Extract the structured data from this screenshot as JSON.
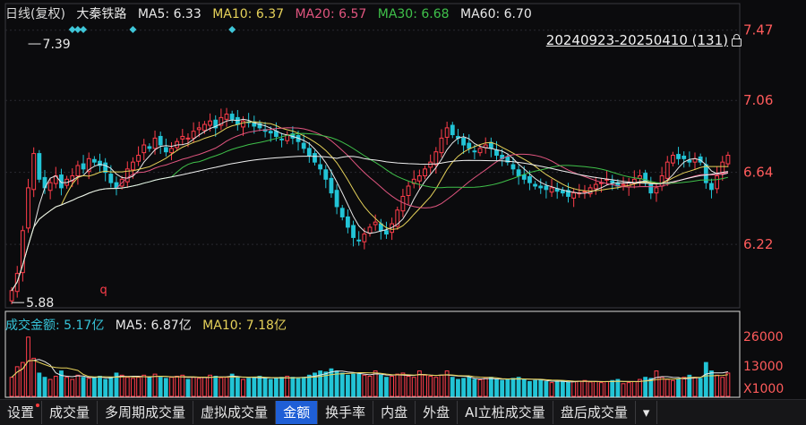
{
  "header": {
    "period": "日线(复权)",
    "stock_name": "大秦铁路",
    "ma": [
      {
        "label": "MA5: 6.33",
        "color": "#e8e8e8"
      },
      {
        "label": "MA10: 6.37",
        "color": "#e6d25a"
      },
      {
        "label": "MA20: 6.57",
        "color": "#e0557f"
      },
      {
        "label": "MA30: 6.68",
        "color": "#3fc04a"
      },
      {
        "label": "MA60: 6.70",
        "color": "#e8e8e8"
      }
    ],
    "range_label": "20240923-20250410 (131)"
  },
  "volume_header": {
    "items": [
      {
        "label": "成交金额: 5.17亿",
        "color": "#e8e8e8",
        "value_color": "#36c3d8"
      },
      {
        "label": "MA5: 6.87亿",
        "color": "#e8e8e8"
      },
      {
        "label": "MA10: 7.18亿",
        "color": "#e6d25a"
      }
    ]
  },
  "chart_data": {
    "type": "candlestick",
    "price_axis": {
      "ticks": [
        "7.47",
        "7.06",
        "6.64",
        "6.22"
      ],
      "ylim": [
        5.86,
        7.5
      ]
    },
    "volume_axis": {
      "ticks": [
        "26000",
        "13000",
        "X1000"
      ]
    },
    "annotations": [
      {
        "text": "7.39",
        "kind": "high"
      },
      {
        "text": "5.88",
        "kind": "low"
      },
      {
        "text": "q",
        "kind": "marker"
      }
    ],
    "colors": {
      "up": "#ff3d4a",
      "down": "#22c4d6",
      "grid": "#2a2a30",
      "axis_text": "#ff5b5b"
    },
    "closes": [
      5.95,
      6.05,
      6.3,
      6.55,
      6.75,
      6.6,
      6.55,
      6.58,
      6.62,
      6.55,
      6.6,
      6.62,
      6.68,
      6.66,
      6.72,
      6.7,
      6.68,
      6.64,
      6.58,
      6.55,
      6.6,
      6.66,
      6.7,
      6.74,
      6.8,
      6.78,
      6.84,
      6.8,
      6.76,
      6.78,
      6.82,
      6.85,
      6.84,
      6.88,
      6.9,
      6.92,
      6.94,
      6.9,
      6.96,
      6.98,
      6.95,
      6.92,
      6.94,
      6.93,
      6.91,
      6.9,
      6.88,
      6.87,
      6.85,
      6.83,
      6.86,
      6.84,
      6.82,
      6.78,
      6.74,
      6.7,
      6.66,
      6.6,
      6.52,
      6.44,
      6.38,
      6.32,
      6.26,
      6.24,
      6.28,
      6.32,
      6.35,
      6.3,
      6.28,
      6.34,
      6.42,
      6.5,
      6.56,
      6.6,
      6.62,
      6.66,
      6.7,
      6.76,
      6.84,
      6.9,
      6.86,
      6.84,
      6.8,
      6.78,
      6.76,
      6.78,
      6.8,
      6.78,
      6.74,
      6.72,
      6.7,
      6.66,
      6.62,
      6.6,
      6.58,
      6.56,
      6.55,
      6.54,
      6.55,
      6.53,
      6.52,
      6.5,
      6.52,
      6.52,
      6.53,
      6.55,
      6.57,
      6.58,
      6.6,
      6.58,
      6.56,
      6.57,
      6.58,
      6.6,
      6.62,
      6.58,
      6.52,
      6.55,
      6.62,
      6.7,
      6.74,
      6.72,
      6.72,
      6.7,
      6.72,
      6.7,
      6.58,
      6.54,
      6.62,
      6.7,
      6.74
    ],
    "volumes": [
      9000,
      14000,
      16000,
      28000,
      18000,
      11000,
      9000,
      8000,
      9500,
      12000,
      9000,
      8000,
      10000,
      9000,
      8500,
      9000,
      9500,
      8000,
      9000,
      11000,
      10000,
      9000,
      8500,
      9000,
      10000,
      9000,
      10500,
      9000,
      8500,
      9000,
      9500,
      10000,
      8000,
      9000,
      8500,
      9000,
      10000,
      9500,
      8800,
      9000,
      10500,
      9000,
      8000,
      8500,
      9000,
      9500,
      8700,
      8000,
      8400,
      9000,
      9500,
      9000,
      8500,
      9000,
      10000,
      11000,
      12000,
      11500,
      13000,
      12000,
      11000,
      10000,
      10500,
      11000,
      10000,
      9500,
      12000,
      10000,
      9000,
      9500,
      10500,
      11000,
      9500,
      9000,
      12000,
      10000,
      9500,
      9000,
      10000,
      12000,
      9000,
      8000,
      8500,
      9000,
      8000,
      7800,
      8500,
      9000,
      8000,
      7500,
      8000,
      8500,
      9000,
      8000,
      7000,
      7500,
      8000,
      7000,
      6500,
      7000,
      7200,
      6800,
      7000,
      7200,
      7500,
      6800,
      7000,
      6500,
      7000,
      7500,
      8000,
      6000,
      6500,
      7000,
      8000,
      9000,
      8500,
      12000,
      9000,
      8000,
      7500,
      8000,
      9000,
      10000,
      9000,
      8500,
      16000,
      12000,
      10000,
      9000,
      11000
    ]
  },
  "tabs": [
    {
      "label": "设置",
      "dot": true
    },
    {
      "label": "成交量"
    },
    {
      "label": "多周期成交量"
    },
    {
      "label": "虚拟成交量"
    },
    {
      "label": "金额",
      "active": true
    },
    {
      "label": "换手率"
    },
    {
      "label": "内盘"
    },
    {
      "label": "外盘"
    },
    {
      "label": "AI立桩成交量"
    },
    {
      "label": "盘后成交量"
    },
    {
      "label": "▾"
    }
  ]
}
